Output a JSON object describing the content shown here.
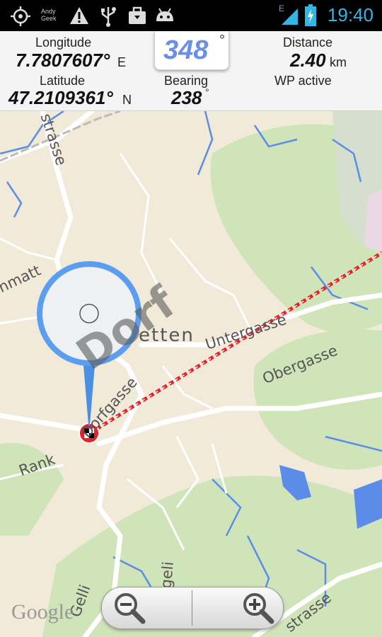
{
  "status_bar": {
    "time": "19:40",
    "network": "E",
    "icons": [
      "gps-icon",
      "app-icon",
      "warning-icon",
      "usb-icon",
      "briefcase-icon",
      "android-icon",
      "signal-icon",
      "battery-icon"
    ],
    "app_icon_text": "Andy Geek"
  },
  "panel": {
    "longitude_label": "Longitude",
    "longitude_value": "7.7807607°",
    "longitude_unit": "E",
    "latitude_label": "Latitude",
    "latitude_value": "47.2109361°",
    "latitude_unit": "N",
    "heading_value": "348",
    "heading_unit": "°",
    "bearing_label": "Bearing",
    "bearing_value": "238",
    "bearing_unit": "°",
    "distance_label": "Distance",
    "distance_value": "2.40",
    "distance_unit": "km",
    "wp_status": "WP active"
  },
  "map": {
    "labels": {
      "strasse_top": "strasse",
      "matt": "nmatt",
      "etten": "etten",
      "untergasse": "Untergasse",
      "obergasse": "Obergasse",
      "dorfgasse": "Dorfgasse",
      "rank": "Rank",
      "gelli_right": "ngeli",
      "gelli_left": "Gelli",
      "strasse_bottom": "strasse",
      "magnifier_text": "Dorf"
    },
    "watermark": "Google",
    "colors": {
      "background": "#f2ead9",
      "forest": "#cfe4b8",
      "water": "#5b8de8",
      "route": "#e8202a",
      "pin": "#4a90e2"
    }
  },
  "zoom": {
    "out_icon": "zoom-out-icon",
    "in_icon": "zoom-in-icon"
  }
}
